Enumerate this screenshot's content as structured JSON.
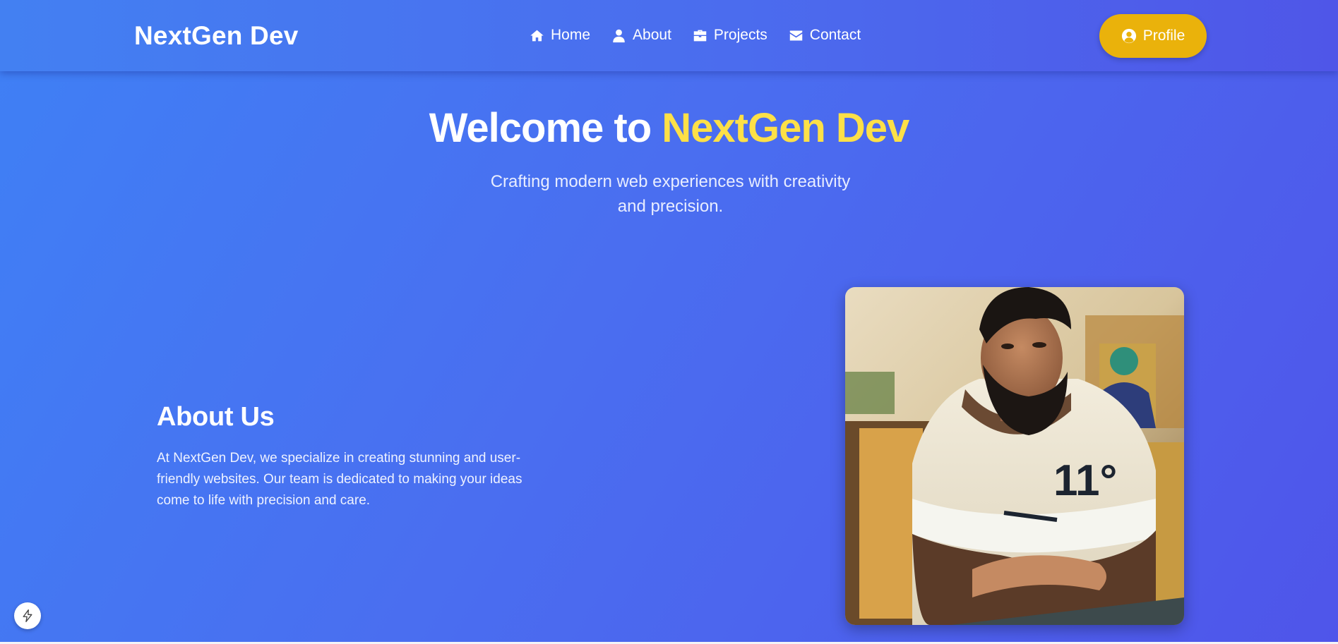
{
  "colors": {
    "accent": "#fde047",
    "profile_button": "#eab20b",
    "background_start": "#3f80f5",
    "background_end": "#4f55ea"
  },
  "navbar": {
    "logo": "NextGen Dev",
    "links": [
      {
        "label": "Home",
        "icon": "home-icon"
      },
      {
        "label": "About",
        "icon": "user-icon"
      },
      {
        "label": "Projects",
        "icon": "briefcase-icon"
      },
      {
        "label": "Contact",
        "icon": "envelope-icon"
      }
    ],
    "profile_button": {
      "label": "Profile",
      "icon": "user-circle-icon"
    }
  },
  "hero": {
    "title_prefix": "Welcome to",
    "title_accent": "NextGen Dev",
    "subtitle": "Crafting modern web experiences with creativity and precision."
  },
  "about": {
    "title": "About Us",
    "text": "At NextGen Dev, we specialize in creating stunning and user-friendly websites. Our team is dedicated to making your ideas come to life with precision and care.",
    "photo_alt": "Bearded man in a cream sweatshirt with 11° print"
  },
  "floating_button": {
    "icon": "bolt-icon"
  }
}
